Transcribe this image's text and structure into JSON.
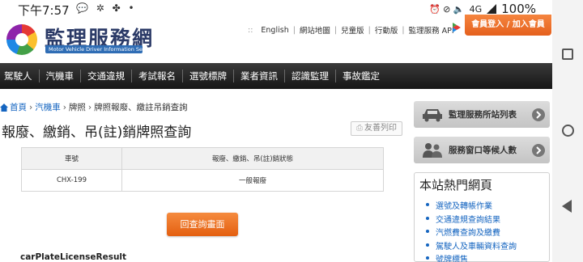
{
  "status_bar": {
    "time": "下午7:57",
    "left_icons": "💬 ✲ ✤ •",
    "right_icons": "⏰ ⊘ 🔈",
    "network": "4G",
    "battery": "100%"
  },
  "header": {
    "logo_title": "監理服務網",
    "logo_subtitle": "Motor Vehicle Driver Information Service",
    "top_links": [
      "English",
      "網站地圖",
      "兒童版",
      "行動版",
      "監理服務 APP"
    ],
    "login_label": "會員登入 / 加入會員"
  },
  "nav": {
    "items": [
      "駕駛人",
      "汽機車",
      "交通違規",
      "考試報名",
      "選號標牌",
      "業者資訊",
      "認識監理",
      "事故鑑定"
    ]
  },
  "breadcrumb": {
    "home": "首頁",
    "level1": "汽機車",
    "level2": "牌照",
    "level3": "牌照報廢、繳註吊銷查詢",
    "separator": "›"
  },
  "page": {
    "title": "報廢、繳銷、吊(註)銷牌照查詢",
    "print_label": "友善列印",
    "back_button": "回查詢畫面",
    "debug_label": "carPlateLicenseResult"
  },
  "table": {
    "headers": [
      "車號",
      "報廢、繳銷、吊(註)銷狀態"
    ],
    "rows": [
      [
        "CHX-199",
        "一般報廢"
      ]
    ]
  },
  "sidebar": {
    "buttons": [
      "監理服務所站列表",
      "服務窗口等候人數"
    ],
    "hot_title": "本站熱門網頁",
    "hot_links": [
      "選號及轉帳作業",
      "交通違規查詢結果",
      "汽燃費查詢及繳費",
      "駕駛人及車輛資料查詢",
      "號牌標售"
    ]
  },
  "colors": {
    "accent_orange": "#e8661c",
    "nav_dark": "#1f1f1f",
    "link_blue": "#1565c0"
  }
}
